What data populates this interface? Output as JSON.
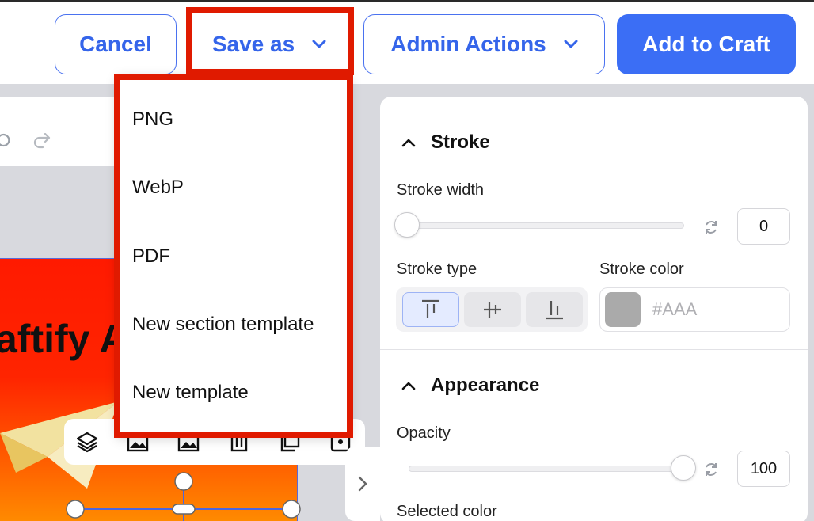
{
  "topbar": {
    "cancel_label": "Cancel",
    "save_as_label": "Save as",
    "admin_actions_label": "Admin Actions",
    "add_to_craft_label": "Add to Craft"
  },
  "save_as_menu": {
    "items": [
      {
        "label": "PNG"
      },
      {
        "label": "WebP"
      },
      {
        "label": "PDF"
      },
      {
        "label": "New section template"
      },
      {
        "label": "New template"
      }
    ]
  },
  "canvas": {
    "artboard_title": "aftify A",
    "toolbar_icons": [
      "layers-icon",
      "image-icon",
      "image-alt-icon",
      "trash-icon",
      "duplicate-icon",
      "more-icon"
    ]
  },
  "panel": {
    "stroke": {
      "heading": "Stroke",
      "width_label": "Stroke width",
      "width_value": "0",
      "type_label": "Stroke type",
      "color_label": "Stroke color",
      "color_value": "#AAA",
      "color_swatch": "#aaaaaa",
      "type_options": [
        "align-top-icon",
        "align-center-icon",
        "align-bottom-icon"
      ],
      "type_selected": 0,
      "width_level": 0
    },
    "appearance": {
      "heading": "Appearance",
      "opacity_label": "Opacity",
      "opacity_value": "100",
      "opacity_level": 1.0,
      "selected_color_label": "Selected color"
    }
  },
  "colors": {
    "accent": "#3b6ef5",
    "highlight": "#e01a00"
  }
}
